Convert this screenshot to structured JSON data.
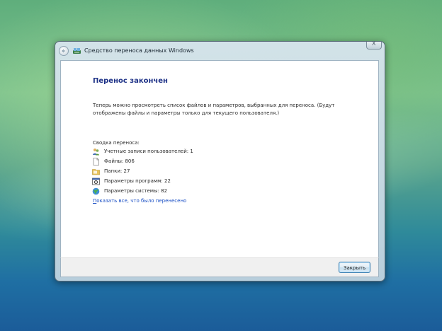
{
  "window": {
    "title": "Средство переноса данных Windows",
    "close_glyph": "X"
  },
  "content": {
    "heading": "Перенос закончен",
    "description": "Теперь можно просмотреть список файлов и параметров, выбранных для переноса. (Будут отображены файлы и параметры только для текущего пользователя.)",
    "summary_label": "Сводка переноса:",
    "summary_items": [
      {
        "label": "Учетные записи пользователей: 1",
        "icon": "users-icon"
      },
      {
        "label": "Файлы: 806",
        "icon": "file-icon"
      },
      {
        "label": "Папки: 27",
        "icon": "folder-icon"
      },
      {
        "label": "Параметры программ: 22",
        "icon": "program-settings-icon"
      },
      {
        "label": "Параметры системы: 82",
        "icon": "globe-icon"
      }
    ],
    "link_first_letter": "П",
    "link_rest": "оказать все, что было перенесено"
  },
  "footer": {
    "close_button": "Закрыть"
  },
  "colors": {
    "heading": "#1e3287",
    "link": "#1a4fc4"
  }
}
